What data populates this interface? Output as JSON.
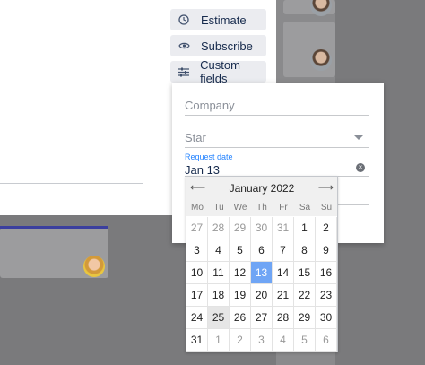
{
  "actions": [
    {
      "label": "Estimate",
      "icon": "clock-icon"
    },
    {
      "label": "Subscribe",
      "icon": "eye-icon"
    },
    {
      "label": "Custom fields",
      "icon": "sliders-icon"
    }
  ],
  "custom_fields": {
    "company_placeholder": "Company",
    "star_placeholder": "Star",
    "request_date_label": "Request date",
    "request_date_value": "Jan 13"
  },
  "calendar": {
    "month_label": "January 2022",
    "weekdays": [
      "Mo",
      "Tu",
      "We",
      "Th",
      "Fr",
      "Sa",
      "Su"
    ],
    "weeks": [
      [
        {
          "d": "27",
          "o": true
        },
        {
          "d": "28",
          "o": true
        },
        {
          "d": "29",
          "o": true
        },
        {
          "d": "30",
          "o": true
        },
        {
          "d": "31",
          "o": true
        },
        {
          "d": "1"
        },
        {
          "d": "2"
        }
      ],
      [
        {
          "d": "3"
        },
        {
          "d": "4"
        },
        {
          "d": "5"
        },
        {
          "d": "6"
        },
        {
          "d": "7"
        },
        {
          "d": "8"
        },
        {
          "d": "9"
        }
      ],
      [
        {
          "d": "10"
        },
        {
          "d": "11"
        },
        {
          "d": "12"
        },
        {
          "d": "13",
          "s": true
        },
        {
          "d": "14"
        },
        {
          "d": "15"
        },
        {
          "d": "16"
        }
      ],
      [
        {
          "d": "17"
        },
        {
          "d": "18"
        },
        {
          "d": "19"
        },
        {
          "d": "20"
        },
        {
          "d": "21"
        },
        {
          "d": "22"
        },
        {
          "d": "23"
        }
      ],
      [
        {
          "d": "24"
        },
        {
          "d": "25",
          "h": true
        },
        {
          "d": "26"
        },
        {
          "d": "27"
        },
        {
          "d": "28"
        },
        {
          "d": "29"
        },
        {
          "d": "30"
        }
      ],
      [
        {
          "d": "31"
        },
        {
          "d": "1",
          "o": true
        },
        {
          "d": "2",
          "o": true
        },
        {
          "d": "3",
          "o": true
        },
        {
          "d": "4",
          "o": true
        },
        {
          "d": "5",
          "o": true
        },
        {
          "d": "6",
          "o": true
        }
      ]
    ]
  },
  "colors": {
    "overlay": "#7a7a7c",
    "selected_day": "#6fa5f5",
    "accent_label": "#2684ff"
  }
}
